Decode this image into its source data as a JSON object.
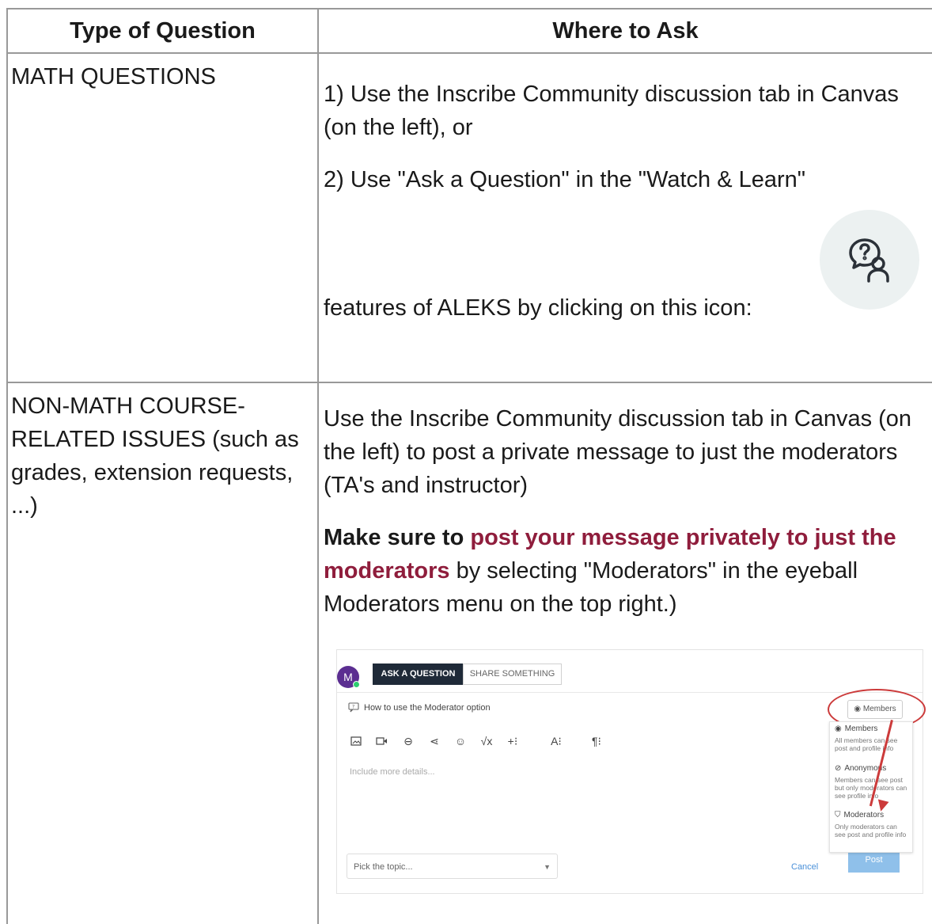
{
  "table": {
    "header_col1": "Type of Question",
    "header_col2": "Where to Ask"
  },
  "math_row": {
    "type": "MATH QUESTIONS",
    "line1": "1) Use the Inscribe Community discussion tab in Canvas (on the left), or",
    "line2": "2) Use \"Ask a Question\" in the \"Watch & Learn\"",
    "line3": "features of ALEKS by clicking on this icon:",
    "icon": "question-people-icon"
  },
  "nonmath_row": {
    "type": "NON-MATH COURSE-RELATED ISSUES (such as grades, extension requests, ...)",
    "para1": "Use the Inscribe Community discussion tab in Canvas (on the left) to post a private message to just the moderators (TA's and instructor)",
    "para2_lead": "Make sure to",
    "para2_highlight": "post your message privately to just the moderators",
    "para2_tail": "by selecting \"Moderators\" in the eyeball Moderators menu on the top right.)"
  },
  "screenshot": {
    "avatar_letter": "M",
    "tab_ask": "ASK A QUESTION",
    "tab_share": "SHARE SOMETHING",
    "question_title": "How to use the Moderator option",
    "members_button": "Members",
    "details_placeholder": "Include more details...",
    "topic_placeholder": "Pick the topic...",
    "cancel": "Cancel",
    "post": "Post",
    "options": [
      {
        "label": "Members",
        "desc": "All members can see post and profile info"
      },
      {
        "label": "Anonymous",
        "desc": "Members can see post but only moderators can see profile info"
      },
      {
        "label": "Moderators",
        "desc": "Only moderators can see post and profile info"
      }
    ],
    "accent_color": "#1f2a38",
    "highlight_color": "#cc3b3b"
  }
}
